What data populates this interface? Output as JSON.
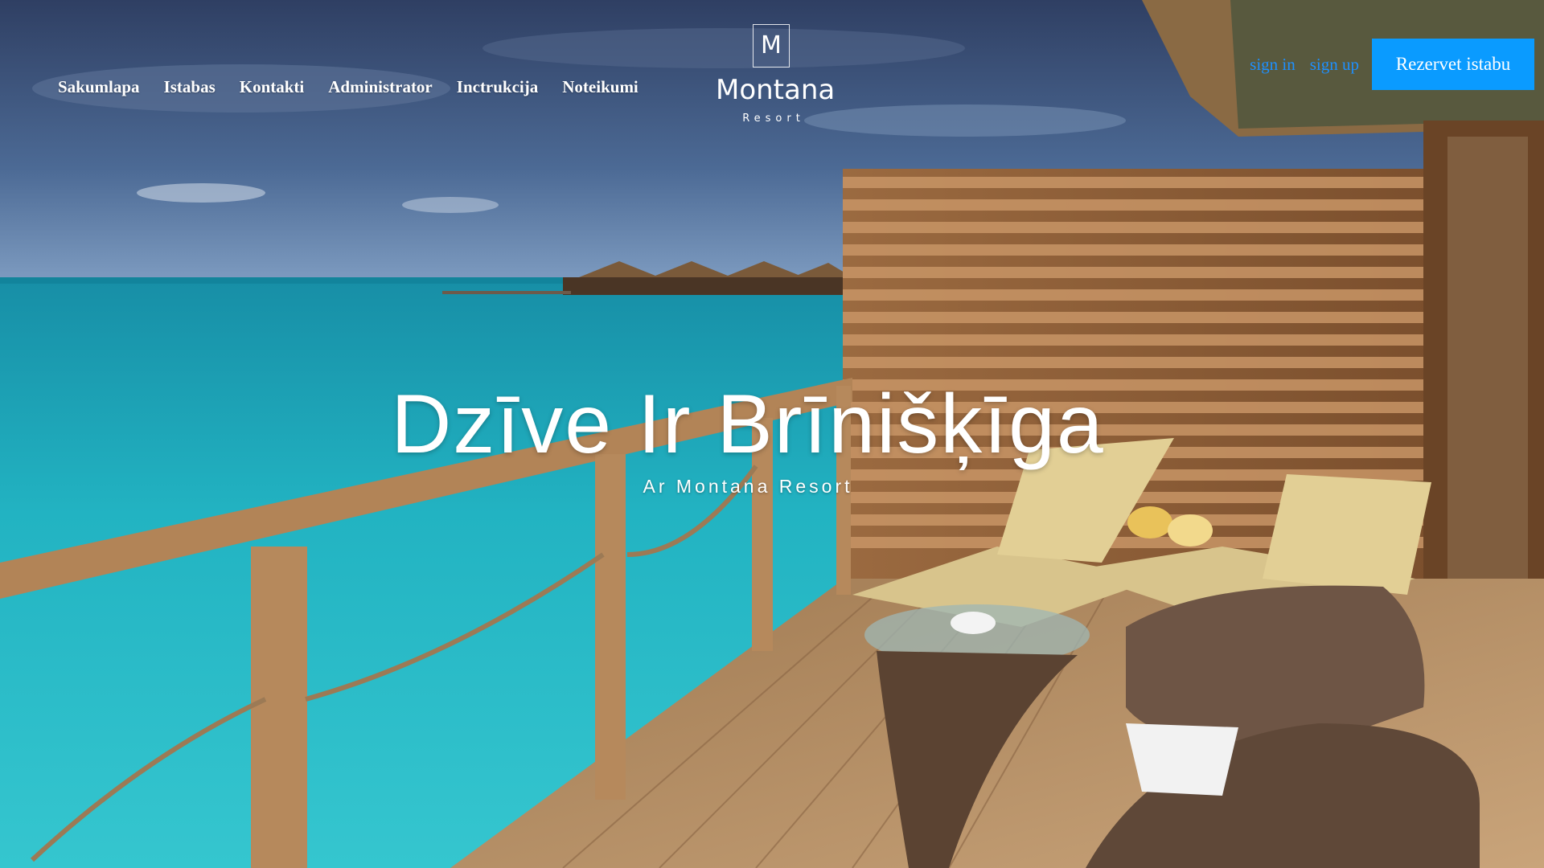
{
  "nav": {
    "items": [
      {
        "label": "Sakumlapa"
      },
      {
        "label": "Istabas"
      },
      {
        "label": "Kontakti"
      },
      {
        "label": "Administrator"
      },
      {
        "label": "Inctrukcija"
      },
      {
        "label": "Noteikumi"
      }
    ]
  },
  "logo": {
    "letter": "M",
    "name": "Montana",
    "sub": "Resort"
  },
  "auth": {
    "sign_in": "sign in",
    "sign_up": "sign up"
  },
  "book_button": "Rezervet istabu",
  "hero": {
    "title": "Dzīve Ir Brīnišķīga",
    "subtitle": "Ar Montana Resort"
  },
  "colors": {
    "accent": "#0a9bff",
    "link": "#1e90ff",
    "text": "#ffffff"
  }
}
